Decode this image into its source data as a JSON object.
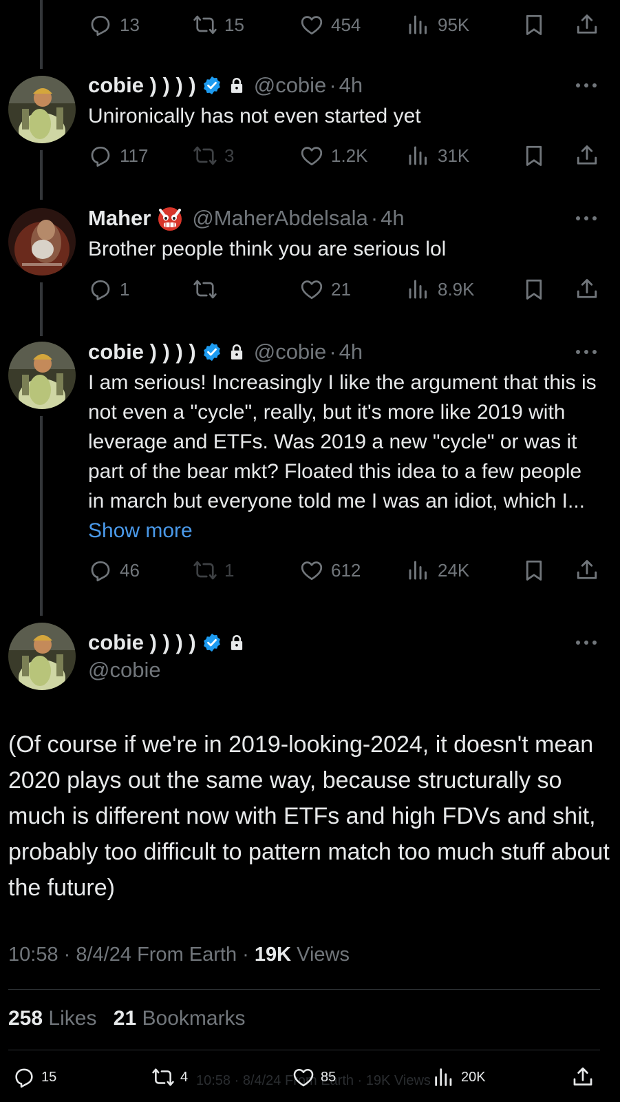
{
  "colors": {
    "background": "#000000",
    "text": "#e7e9ea",
    "muted": "#71767b",
    "accent": "#4a99e9",
    "verified": "#1d9bf0"
  },
  "top_actions": {
    "replies": "13",
    "reposts": "15",
    "likes": "454",
    "views": "95K"
  },
  "tweets": [
    {
      "name": "cobie ) ) ) )",
      "verified": true,
      "locked": true,
      "handle": "@cobie",
      "dot": "·",
      "time": "4h",
      "text": "Unironically has not even started yet",
      "actions": {
        "replies": "117",
        "reposts": "3",
        "likes": "1.2K",
        "views": "31K"
      }
    },
    {
      "name": "Maher",
      "emoji": "👹",
      "handle": "@MaherAbdelsala",
      "dot": "·",
      "time": "4h",
      "text": "Brother people think you are serious lol",
      "actions": {
        "replies": "1",
        "reposts": "",
        "likes": "21",
        "views": "8.9K"
      }
    },
    {
      "name": "cobie ) ) ) )",
      "verified": true,
      "locked": true,
      "handle": "@cobie",
      "dot": "·",
      "time": "4h",
      "text": "I am serious! Increasingly I like the argument that this is not even a \"cycle\", really, but it's more like 2019 with leverage and ETFs. Was 2019 a new \"cycle\" or was it part of the bear mkt? Floated this idea to a few people in march but everyone told me I was an idiot, which I...",
      "show_more": "Show more",
      "actions": {
        "replies": "46",
        "reposts": "1",
        "likes": "612",
        "views": "24K"
      }
    }
  ],
  "main_tweet": {
    "name": "cobie ) ) ) )",
    "handle": "@cobie",
    "text": "(Of course if we're in 2019-looking-2024, it doesn't mean 2020 plays out the same way, because structurally so much is different now with ETFs and high FDVs and shit, probably too difficult to pattern match too much stuff about the future)",
    "time": "10:58",
    "date": "8/4/24",
    "source": "From Earth",
    "views_count": "19K",
    "views_label": "Views",
    "likes_count": "258",
    "likes_label": "Likes",
    "bookmarks_count": "21",
    "bookmarks_label": "Bookmarks"
  },
  "bottom_bar": {
    "replies": "15",
    "reposts": "4",
    "likes": "85",
    "views": "20K"
  },
  "ghost_overlay": "10:58 · 8/4/24 From Earth · 19K Views"
}
